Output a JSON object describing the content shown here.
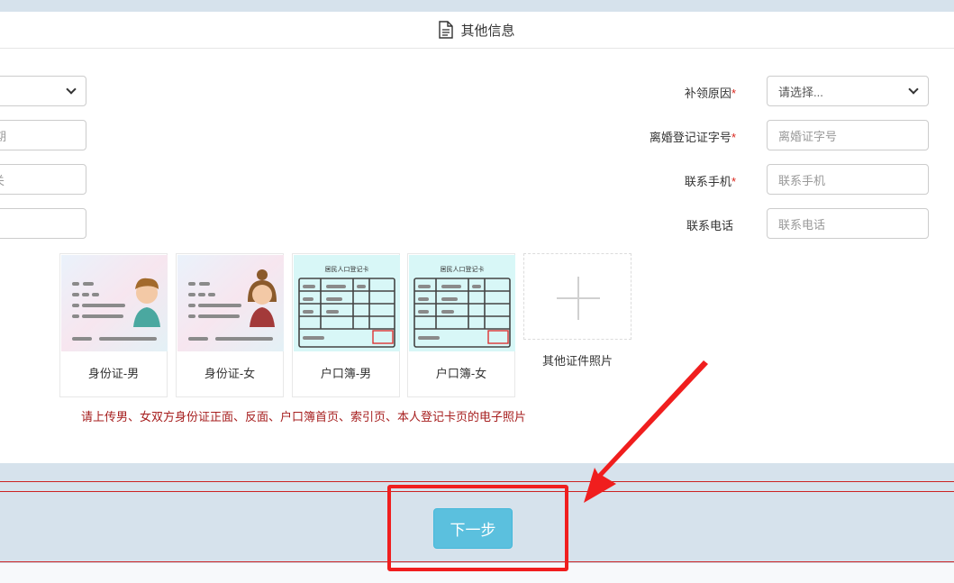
{
  "header": {
    "icon": "document-icon",
    "title": "其他信息"
  },
  "left_fields": [
    {
      "placeholder": ""
    },
    {
      "placeholder": "期"
    },
    {
      "placeholder": "关"
    },
    {
      "placeholder": ""
    }
  ],
  "right_fields": [
    {
      "label": "补领原因",
      "required": true,
      "type": "select",
      "value": "请选择..."
    },
    {
      "label": "离婚登记证字号",
      "required": true,
      "type": "input",
      "placeholder": "离婚证字号"
    },
    {
      "label": "联系手机",
      "required": true,
      "type": "input",
      "placeholder": "联系手机"
    },
    {
      "label": "联系电话",
      "required": false,
      "type": "input",
      "placeholder": "联系电话"
    }
  ],
  "required_mark": "*",
  "uploads": [
    {
      "caption": "身份证-男",
      "icon": "id-card-male-image"
    },
    {
      "caption": "身份证-女",
      "icon": "id-card-female-image"
    },
    {
      "caption": "户口簿-男",
      "icon": "household-register-male-image"
    },
    {
      "caption": "户口簿-女",
      "icon": "household-register-female-image"
    },
    {
      "caption": "其他证件照片",
      "icon": "plus-icon"
    }
  ],
  "hint": "请上传男、女双方身份证正面、反面、户口簿首页、索引页、本人登记卡页的电子照片",
  "next_button": "下一步",
  "colors": {
    "accent": "#5bc0de",
    "required": "#d9251c",
    "hint": "#a61e1e",
    "annotation": "#f01e1e",
    "background": "#d6e2ec"
  }
}
